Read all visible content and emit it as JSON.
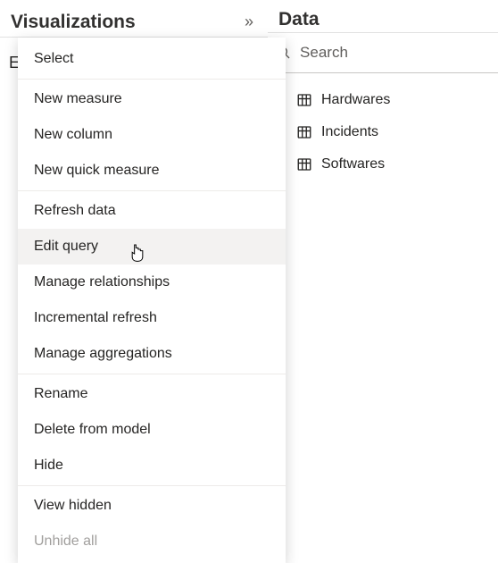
{
  "panels": {
    "visualizations": {
      "title": "Visualizations"
    },
    "data": {
      "title": "Data",
      "search_placeholder": "Search",
      "tables": [
        {
          "name": "Hardwares"
        },
        {
          "name": "Incidents"
        },
        {
          "name": "Softwares"
        }
      ]
    }
  },
  "visible_fragment": "E",
  "context_menu": {
    "groups": [
      [
        {
          "label": "Select",
          "enabled": true
        }
      ],
      [
        {
          "label": "New measure",
          "enabled": true
        },
        {
          "label": "New column",
          "enabled": true
        },
        {
          "label": "New quick measure",
          "enabled": true
        }
      ],
      [
        {
          "label": "Refresh data",
          "enabled": true
        },
        {
          "label": "Edit query",
          "enabled": true,
          "hovered": true
        },
        {
          "label": "Manage relationships",
          "enabled": true
        },
        {
          "label": "Incremental refresh",
          "enabled": true
        },
        {
          "label": "Manage aggregations",
          "enabled": true
        }
      ],
      [
        {
          "label": "Rename",
          "enabled": true
        },
        {
          "label": "Delete from model",
          "enabled": true
        },
        {
          "label": "Hide",
          "enabled": true
        }
      ],
      [
        {
          "label": "View hidden",
          "enabled": true
        },
        {
          "label": "Unhide all",
          "enabled": false
        }
      ]
    ]
  }
}
